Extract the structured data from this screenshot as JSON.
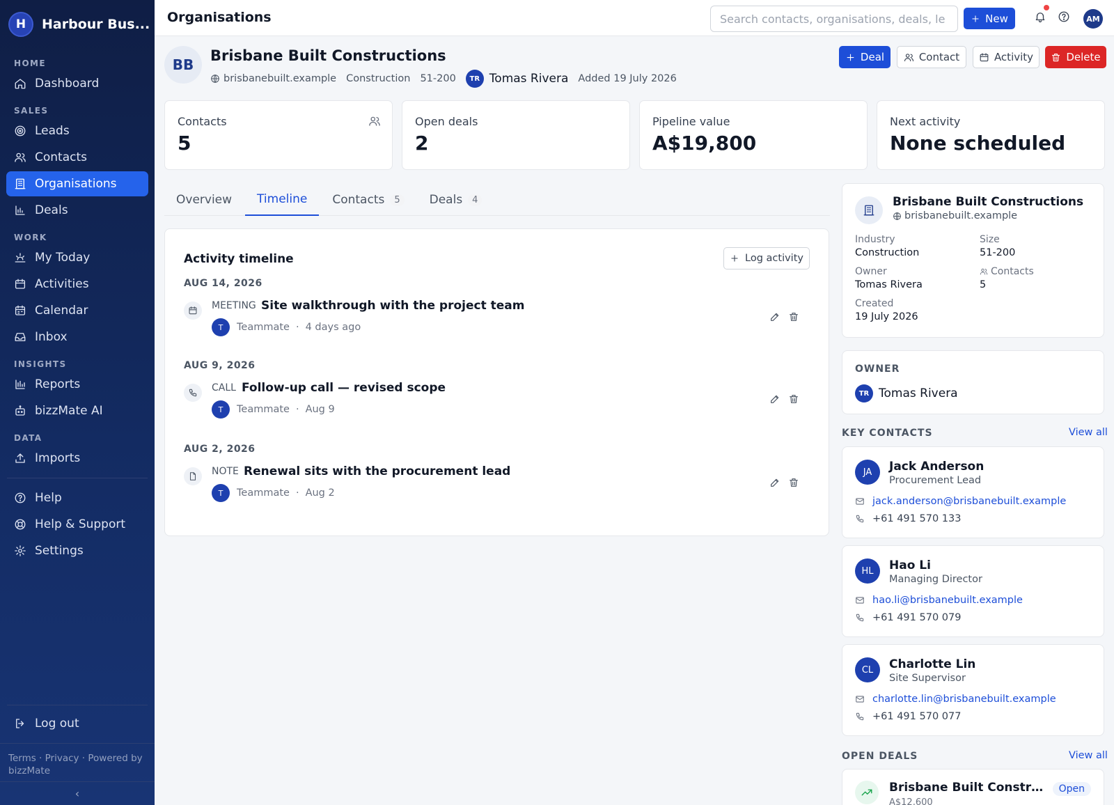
{
  "sidebar": {
    "brand": {
      "initial": "H",
      "name": "Harbour Bus..."
    },
    "sections": {
      "home": "HOME",
      "sales": "SALES",
      "work": "WORK",
      "insights": "INSIGHTS",
      "data": "DATA"
    },
    "items": {
      "dashboard": "Dashboard",
      "leads": "Leads",
      "contacts": "Contacts",
      "organisations": "Organisations",
      "deals": "Deals",
      "my_today": "My Today",
      "activities": "Activities",
      "calendar": "Calendar",
      "inbox": "Inbox",
      "reports": "Reports",
      "bizzmate_ai": "bizzMate AI",
      "imports": "Imports",
      "help": "Help",
      "help_support": "Help & Support",
      "settings": "Settings",
      "logout": "Log out"
    },
    "active_item": "organisations",
    "footer": "Terms · Privacy · Powered by bizzMate",
    "collapse_glyph": "‹"
  },
  "topbar": {
    "title": "Organisations",
    "search_placeholder": "Search contacts, organisations, deals, le",
    "new_label": "New",
    "avatar": "AM"
  },
  "org": {
    "initials": "BB",
    "name": "Brisbane Built Constructions",
    "domain": "brisbanebuilt.example",
    "industry": "Construction",
    "size": "51-200",
    "owner_initials": "TR",
    "owner": "Tomas Rivera",
    "added": "Added 19 July 2026"
  },
  "actions": {
    "deal": "Deal",
    "contact": "Contact",
    "activity": "Activity",
    "delete": "Delete"
  },
  "stats": [
    {
      "label": "Contacts",
      "value": "5"
    },
    {
      "label": "Open deals",
      "value": "2"
    },
    {
      "label": "Pipeline value",
      "value": "A$19,800"
    },
    {
      "label": "Next activity",
      "value": "None scheduled"
    }
  ],
  "tabs": [
    {
      "label": "Overview",
      "count": ""
    },
    {
      "label": "Timeline",
      "count": ""
    },
    {
      "label": "Contacts",
      "count": "5"
    },
    {
      "label": "Deals",
      "count": "4"
    }
  ],
  "active_tab": "Timeline",
  "timeline": {
    "title": "Activity timeline",
    "log_label": "Log activity",
    "groups": [
      {
        "date": "AUG 14, 2026",
        "type": "MEETING",
        "icon": "calendar-icon",
        "subject": "Site walkthrough with the project team",
        "by_initial": "T",
        "by": "Teammate",
        "when": "4 days ago"
      },
      {
        "date": "AUG 9, 2026",
        "type": "CALL",
        "icon": "phone-icon",
        "subject": "Follow-up call — revised scope",
        "by_initial": "T",
        "by": "Teammate",
        "when": "Aug 9"
      },
      {
        "date": "AUG 2, 2026",
        "type": "NOTE",
        "icon": "note-icon",
        "subject": "Renewal sits with the procurement lead",
        "by_initial": "T",
        "by": "Teammate",
        "when": "Aug 2"
      }
    ]
  },
  "org_info": {
    "name": "Brisbane Built Constructions",
    "domain": "brisbanebuilt.example",
    "fields": {
      "industry_label": "Industry",
      "industry": "Construction",
      "size_label": "Size",
      "size": "51-200",
      "owner_label": "Owner",
      "owner": "Tomas Rivera",
      "contacts_label": "Contacts",
      "contacts": "5",
      "created_label": "Created",
      "created": "19 July 2026"
    }
  },
  "owner_card": {
    "heading": "OWNER",
    "initials": "TR",
    "name": "Tomas Rivera"
  },
  "key_contacts": {
    "heading": "KEY CONTACTS",
    "view_all": "View all",
    "items": [
      {
        "initials": "JA",
        "name": "Jack Anderson",
        "role": "Procurement Lead",
        "email": "jack.anderson@brisbanebuilt.example",
        "phone": "+61 491 570 133"
      },
      {
        "initials": "HL",
        "name": "Hao Li",
        "role": "Managing Director",
        "email": "hao.li@brisbanebuilt.example",
        "phone": "+61 491 570 079"
      },
      {
        "initials": "CL",
        "name": "Charlotte Lin",
        "role": "Site Supervisor",
        "email": "charlotte.lin@brisbanebuilt.example",
        "phone": "+61 491 570 077"
      }
    ]
  },
  "open_deals": {
    "heading": "OPEN DEALS",
    "view_all": "View all",
    "items": [
      {
        "name": "Brisbane Built Construc...",
        "value": "A$12,600",
        "status": "Open"
      }
    ]
  }
}
